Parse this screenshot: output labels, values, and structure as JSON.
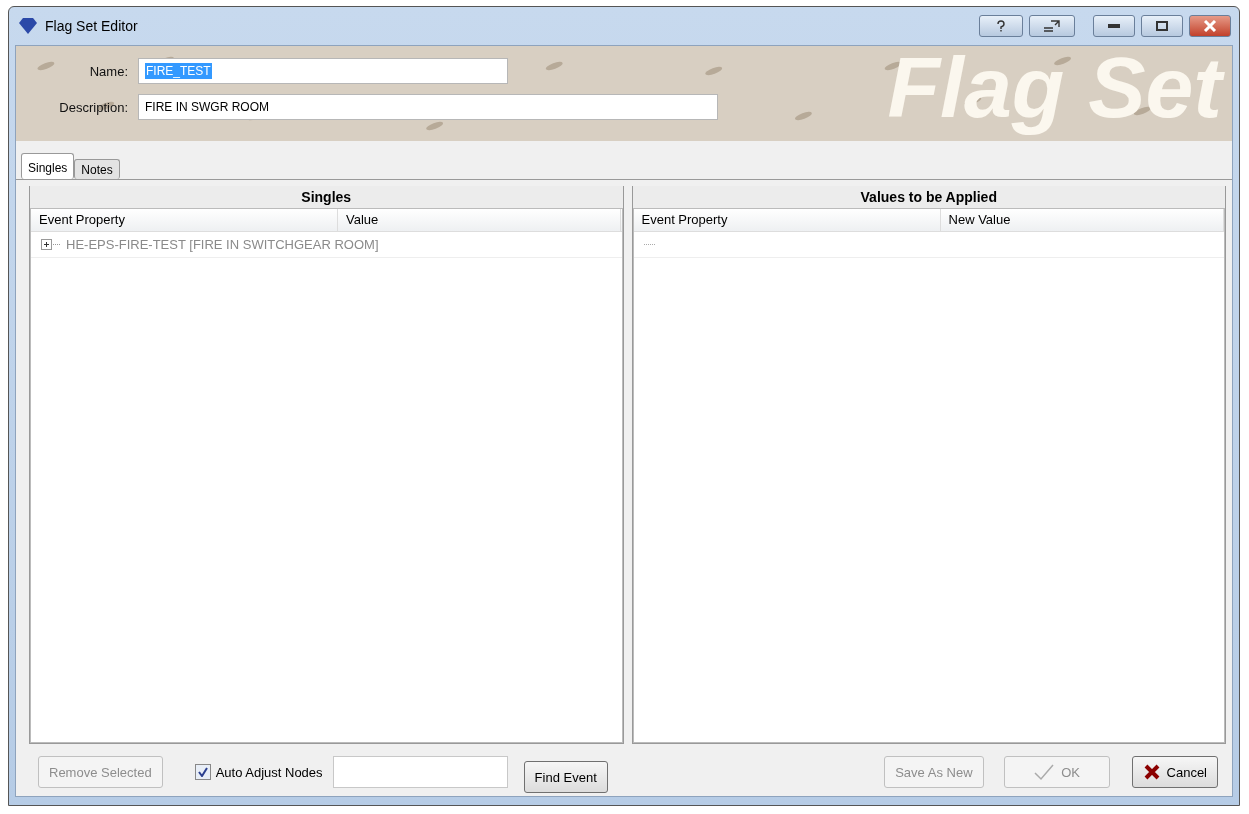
{
  "window": {
    "title": "Flag Set Editor"
  },
  "banner": {
    "heading": "Flag Set"
  },
  "fields": [
    {
      "label": "Name:",
      "value": "FIRE_TEST",
      "selected": true
    },
    {
      "label": "Description:",
      "value": "FIRE IN SWGR ROOM",
      "selected": false
    }
  ],
  "tabs": [
    {
      "label": "Singles",
      "selected": true
    },
    {
      "label": "Notes",
      "selected": false
    }
  ],
  "singles": {
    "title": "Singles",
    "columns": [
      "Event Property",
      "Value"
    ],
    "rows": [
      {
        "text": "HE-EPS-FIRE-TEST  [FIRE IN SWITCHGEAR ROOM]",
        "expanded": false,
        "disabled": true
      }
    ]
  },
  "applied": {
    "title": "Values to be Applied",
    "columns": [
      "Event Property",
      "New Value"
    ]
  },
  "footer": {
    "remove": {
      "label": "Remove Selected",
      "disabled": true
    },
    "auto_adjust": {
      "label": "Auto Adjust Nodes",
      "checked": true
    },
    "find": {
      "label": "Find Event",
      "disabled": false
    },
    "buttons": [
      {
        "kind": "save",
        "label": "Save As New",
        "disabled": true
      },
      {
        "kind": "ok",
        "label": "OK",
        "disabled": true
      },
      {
        "kind": "cancel",
        "label": "Cancel",
        "disabled": false
      }
    ]
  }
}
